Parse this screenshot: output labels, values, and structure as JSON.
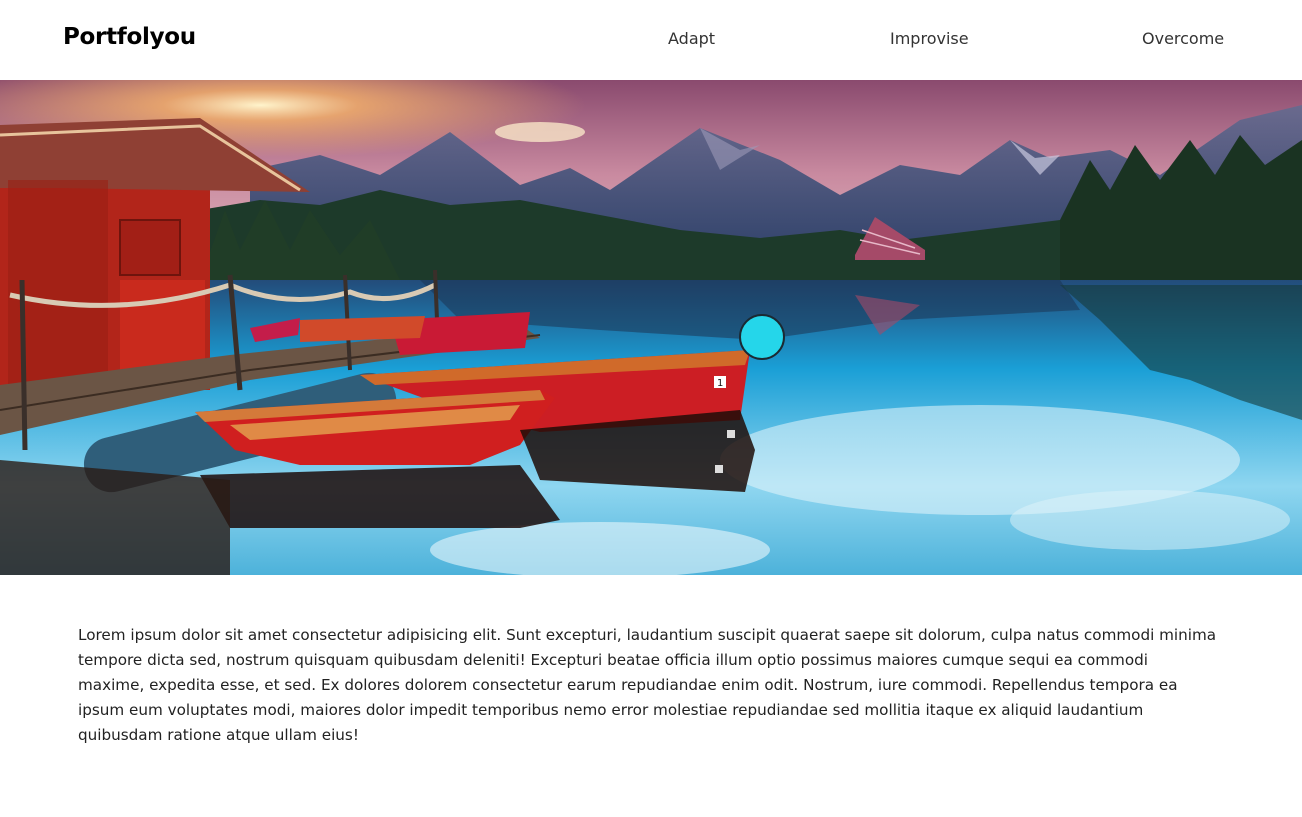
{
  "brand": {
    "name": "Portfolyou"
  },
  "nav": {
    "items": [
      {
        "label": "Adapt"
      },
      {
        "label": "Improvise"
      },
      {
        "label": "Overcome"
      }
    ]
  },
  "hero": {
    "boat_numbers": [
      "1",
      "3",
      "4"
    ]
  },
  "content": {
    "paragraph": "Lorem ipsum dolor sit amet consectetur adipisicing elit. Sunt excepturi, laudantium suscipit quaerat saepe sit dolorum, culpa natus commodi minima tempore dicta sed, nostrum quisquam quibusdam deleniti! Excepturi beatae officia illum optio possimus maiores cumque sequi ea commodi maxime, expedita esse, et sed. Ex dolores dolorem consectetur earum repudiandae enim odit. Nostrum, iure commodi. Repellendus tempora ea ipsum eum voluptates modi, maiores dolor impedit temporibus nemo error molestiae repudiandae sed mollitia itaque ex aliquid laudantium quibusdam ratione atque ullam eius!"
  },
  "colors": {
    "cursor": "#25d6ea",
    "boat_red": "#d01f1f",
    "water": "#1a9fd6"
  }
}
